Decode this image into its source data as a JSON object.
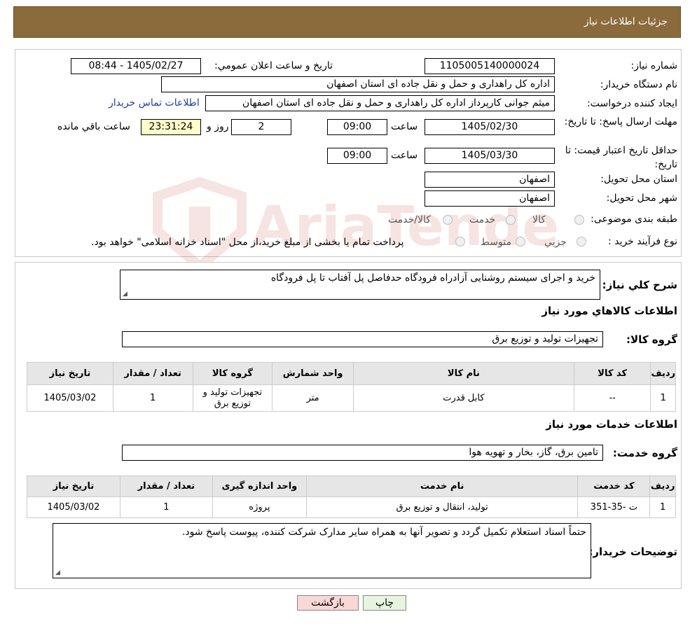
{
  "header": {
    "title": "جزئیات اطلاعات نیاز"
  },
  "info": {
    "need_number_label": "شماره نیاز:",
    "need_number": "1105005140000024",
    "announce_label": "تاریخ و ساعت اعلان عمومي:",
    "announce_value": "1405/02/27 - 08:44",
    "buyer_org_label": "نام دستگاه خریدار:",
    "buyer_org": "اداره کل راهداری و حمل و نقل جاده ای استان اصفهان",
    "creator_label": "ایجاد کننده درخواست:",
    "creator": "میثم جوانی کارپرداز اداره کل راهداری و حمل و نقل جاده ای استان اصفهان",
    "contact_link": "اطلاعات تماس خریدار",
    "reply_deadline_label": "مهلت ارسال پاسخ: تا تاریخ:",
    "reply_date": "1405/02/30",
    "time_label": "ساعت",
    "reply_time": "09:00",
    "days": "2",
    "days_label": "روز و",
    "remaining_time": "23:31:24",
    "remaining_label": "ساعت باقي مانده",
    "price_validity_label": "حداقل تاریخ اعتبار قیمت: تا تاریخ:",
    "price_date": "1405/03/30",
    "price_time": "09:00",
    "province_label": "استان محل تحویل:",
    "province": "اصفهان",
    "city_label": "شهر محل تحویل:",
    "city": "اصفهان",
    "category_label": "طبقه بندی موضوعی:",
    "category_options": [
      "کالا",
      "خدمت",
      "کالا/خدمت"
    ],
    "process_label": "نوع فرآیند خرید :",
    "process_options": [
      "جزیي",
      "متوسط"
    ],
    "process_note": "پرداخت تمام یا بخشی از مبلغ خرید،از محل \"اسناد خزانه اسلامی\" خواهد بود."
  },
  "details": {
    "summary_label": "شرح کلي نیاز:",
    "summary": "خرید و اجرای سیستم روشنایی آزادراه فرودگاه حدفاصل پل آفتاب تا پل فرودگاه",
    "goods_title": "اطلاعات کالاهاي مورد نیاز",
    "goods_group_label": "گروه کالا:",
    "goods_group": "تجهیزات تولید و توزیع برق",
    "goods_table": {
      "headers": [
        "ردیف",
        "کد کالا",
        "نام کالا",
        "واحد شمارش",
        "گروه کالا",
        "تعداد / مقدار",
        "تاریخ نیاز"
      ],
      "rows": [
        [
          "1",
          "--",
          "کابل قدرت",
          "متر",
          "تجهیزات تولید و توزیع برق",
          "1",
          "1405/03/02"
        ]
      ]
    },
    "services_title": "اطلاعات خدمات مورد نیاز",
    "service_group_label": "گروه خدمت:",
    "service_group": "تامین برق، گاز، بخار و تهویه هوا",
    "services_table": {
      "headers": [
        "ردیف",
        "کد خدمت",
        "نام خدمت",
        "واحد اندازه گیری",
        "تعداد / مقدار",
        "تاریخ نیاز"
      ],
      "rows": [
        [
          "1",
          "ت -35-351",
          "تولید، انتقال و توزیع برق",
          "پروژه",
          "1",
          "1405/03/02"
        ]
      ]
    },
    "buyer_notes_label": "توضیحات خریدار:",
    "buyer_notes": "حتماً اسناد استعلام تکمیل گردد و تصویر آنها به همراه سایر مدارک شرکت کننده، پیوست پاسخ شود."
  },
  "actions": {
    "print": "چاپ",
    "back": "بازگشت"
  },
  "watermark": "AriaTender.neT",
  "colors": {
    "header_bg": "#8b6b3c",
    "remaining_bg": "#ffffcc",
    "back_bg": "#f8d7d7",
    "print_bg": "#e6f4e0"
  }
}
